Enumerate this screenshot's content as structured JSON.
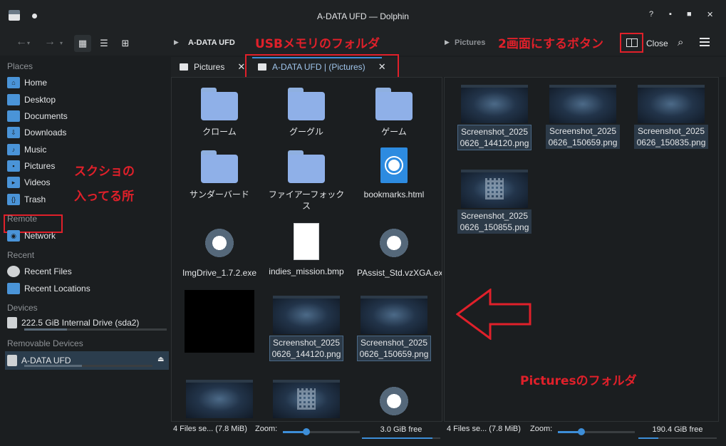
{
  "window": {
    "title": "A-DATA UFD — Dolphin",
    "help_label": "?",
    "min_label": "▪",
    "max_label": "■",
    "close_label": "✕"
  },
  "toolbar": {
    "back_icon": "←",
    "forward_icon": "→",
    "view_icons_glyph": "▦",
    "view_details_glyph": "☰",
    "view_tree_glyph": "⊞",
    "breadcrumb_left": "A-DATA UFD",
    "breadcrumb_right": "Pictures",
    "close_split_label": "Close",
    "search_glyph": "⌕"
  },
  "sidebar": {
    "sections": {
      "places": "Places",
      "remote": "Remote",
      "recent": "Recent",
      "devices": "Devices",
      "removable": "Removable Devices"
    },
    "places": [
      "Home",
      "Desktop",
      "Documents",
      "Downloads",
      "Music",
      "Pictures",
      "Videos",
      "Trash"
    ],
    "remote": [
      "Network"
    ],
    "recent": [
      "Recent Files",
      "Recent Locations"
    ],
    "devices": [
      "222.5 GiB Internal Drive (sda2)"
    ],
    "removable": [
      "A-DATA UFD"
    ],
    "eject_glyph": "⏏"
  },
  "tabs": [
    {
      "label": "Pictures",
      "close": "✕"
    },
    {
      "label": "A-DATA UFD | (Pictures)",
      "close": "✕"
    }
  ],
  "left_pane": {
    "items": [
      {
        "name": "クローム",
        "type": "folder"
      },
      {
        "name": "グーグル",
        "type": "folder"
      },
      {
        "name": "ゲーム",
        "type": "folder"
      },
      {
        "name": "サンダーバード",
        "type": "folder"
      },
      {
        "name": "ファイアーフォックス",
        "type": "folder"
      },
      {
        "name": "bookmarks.html",
        "type": "html"
      },
      {
        "name": "ImgDrive_1.7.2.exe",
        "type": "exe"
      },
      {
        "name": "indies_mission.bmp",
        "type": "bmp"
      },
      {
        "name": "PAssist_Std.vzXGA.exe",
        "type": "exe"
      },
      {
        "name": "",
        "type": "black-thumb"
      },
      {
        "name": "Screenshot_20250626_144120.png",
        "type": "screenshot"
      },
      {
        "name": "Screenshot_20250626_150659.png",
        "type": "screenshot"
      }
    ],
    "status": "4 Files se... (7.8 MiB)",
    "zoom_label": "Zoom:",
    "free_space": "3.0 GiB free",
    "zoom_level": 0.31,
    "free_fill": 0.9
  },
  "right_pane": {
    "items": [
      {
        "name": "Screenshot_20250626_144120.png"
      },
      {
        "name": "Screenshot_20250626_150659.png"
      },
      {
        "name": "Screenshot_20250626_150835.png"
      },
      {
        "name": "Screenshot_20250626_150855.png"
      }
    ],
    "status": "4 Files se... (7.8 MiB)",
    "zoom_label": "Zoom:",
    "free_space": "190.4 GiB free",
    "zoom_level": 0.31,
    "free_fill": 0.25
  },
  "annotations": {
    "usb_folder": "USBメモリのフォルダ",
    "split_button": "2画面にするボタン",
    "screenshot_location_1": "スクショの",
    "screenshot_location_2": "入ってる所",
    "pictures_folder": "Picturesのフォルダ"
  },
  "colors": {
    "accent": "#3d8ed8",
    "annotation_red": "#e0202a",
    "background": "#1b1e20"
  }
}
